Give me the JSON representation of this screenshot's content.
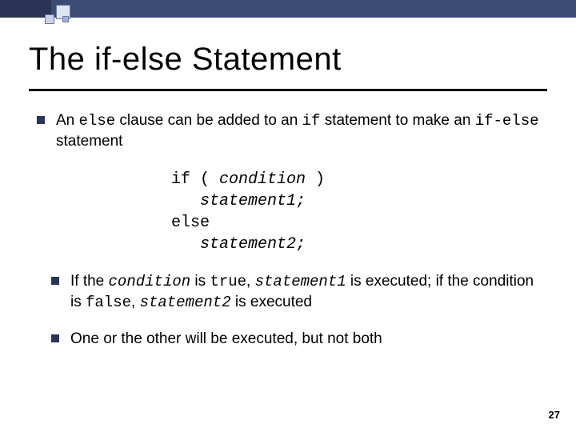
{
  "slide": {
    "title": "The if-else Statement",
    "bullets": {
      "b1": {
        "t1": "An ",
        "code1": "else",
        "t2": " clause can be added to an ",
        "code2": "if",
        "t3": " statement to make an ",
        "code3": "if-else",
        "t4": " statement"
      }
    },
    "code": {
      "l1a": "if ( ",
      "l1b": "condition",
      "l1c": " )",
      "l2a": "   ",
      "l2b": "statement1;",
      "l3": "else",
      "l4a": "   ",
      "l4b": "statement2;"
    },
    "sub": {
      "s1": {
        "t1": "If the ",
        "c1": "condition",
        "t2": " is ",
        "c2": "true",
        "t3": ", ",
        "c3": "statement1",
        "t4": " is executed;  if the condition is ",
        "c4": "false",
        "t5": ", ",
        "c5": "statement2",
        "t6": " is executed"
      },
      "s2": "One or the other will be executed, but not both"
    },
    "pagenum": "27"
  }
}
